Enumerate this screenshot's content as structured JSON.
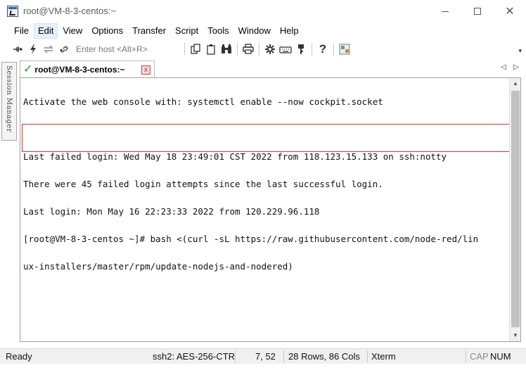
{
  "window": {
    "title": "root@VM-8-3-centos:~"
  },
  "menu": {
    "items": [
      "File",
      "Edit",
      "View",
      "Options",
      "Transfer",
      "Script",
      "Tools",
      "Window",
      "Help"
    ],
    "active": "Edit"
  },
  "toolbar": {
    "host_placeholder": "Enter host <Alt+R>"
  },
  "session_manager": {
    "label": "Session Manager"
  },
  "tab": {
    "label": "root@VM-8-3-centos:~",
    "status_color": "#1aa31a",
    "close_glyph": "x"
  },
  "terminal": {
    "lines": [
      "Activate the web console with: systemctl enable --now cockpit.socket",
      "",
      "Last failed login: Wed May 18 23:49:01 CST 2022 from 118.123.15.133 on ssh:notty",
      "There were 45 failed login attempts since the last successful login.",
      "Last login: Mon May 16 22:23:33 2022 from 120.229.96.118",
      "[root@VM-8-3-centos ~]# bash <(curl -sL https://raw.githubusercontent.com/node-red/lin",
      "ux-installers/master/rpm/update-nodejs-and-nodered)"
    ],
    "highlight_color": "#e03030"
  },
  "status": {
    "ready": "Ready",
    "cipher": "ssh2: AES-256-CTR",
    "cursor": "7, 52",
    "size": "28 Rows, 86 Cols",
    "terminal_type": "Xterm",
    "cap": "CAP",
    "num": "NUM"
  }
}
